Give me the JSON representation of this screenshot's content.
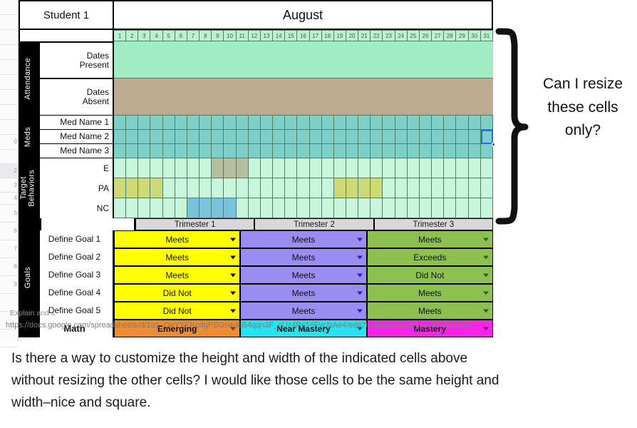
{
  "sheet": {
    "student_label": "Student 1",
    "month": "August",
    "days": [
      "1",
      "2",
      "3",
      "4",
      "5",
      "6",
      "7",
      "8",
      "9",
      "10",
      "11",
      "12",
      "13",
      "14",
      "15",
      "16",
      "17",
      "18",
      "19",
      "20",
      "21",
      "22",
      "23",
      "24",
      "25",
      "26",
      "27",
      "28",
      "29",
      "30",
      "31"
    ],
    "sections": [
      {
        "name": "Attendance",
        "rows": [
          "Dates\nPresent",
          "Dates\nAbsent"
        ]
      },
      {
        "name": "Meds",
        "rows": [
          "Med Name 1",
          "Med Name 2",
          "Med Name 3"
        ]
      },
      {
        "name": "Target\nBehaviors",
        "rows": [
          "E",
          "PA",
          "NC"
        ]
      },
      {
        "name": "Goals",
        "rows": [
          "Define Goal 1",
          "Define Goal 2",
          "Define Goal 3",
          "Define Goal 4",
          "Define Goal 5",
          "Math"
        ]
      }
    ],
    "trimesters": [
      "Trimester 1",
      "Trimester 2",
      "Trimester 3"
    ],
    "goal_values": [
      {
        "label": "Define Goal 1",
        "t1": "Meets",
        "t2": "Meets",
        "t3": "Meets"
      },
      {
        "label": "Define Goal 2",
        "t1": "Meets",
        "t2": "Meets",
        "t3": "Exceeds"
      },
      {
        "label": "Define Goal 3",
        "t1": "Meets",
        "t2": "Meets",
        "t3": "Did Not"
      },
      {
        "label": "Define Goal 4",
        "t1": "Did Not",
        "t2": "Meets",
        "t3": "Meets"
      },
      {
        "label": "Define Goal 5",
        "t1": "Did Not",
        "t2": "Meets",
        "t3": "Meets"
      },
      {
        "label": "Math",
        "t1": "Emerging",
        "t2": "Near Mastery",
        "t3": "Mastery"
      }
    ],
    "row_gutter_numbers": [
      "",
      "",
      "",
      "",
      "",
      "",
      "",
      "",
      "",
      "0",
      "",
      "2",
      "3",
      "4",
      "5",
      "6",
      "7",
      "8",
      "9"
    ]
  },
  "colors": {
    "present": "#9fecc5",
    "absent": "#bdab8f",
    "meds": "#7fcfc9",
    "behavior": "#c8f5dc",
    "behavior_e_highlight": "#b5bfa0",
    "behavior_pa_highlight": "#cddb77",
    "behavior_nc_highlight": "#79c3da",
    "grid_line": "#4e7f5e",
    "trimester_header": "#d8d8d8",
    "t1": "#ffff00",
    "t2": "#9a8cf0",
    "t3": "#8cc152",
    "math_t1": "#f08b31",
    "math_t2": "#27e2f2",
    "math_t3": "#f723e8",
    "selection": "#1a73e8"
  },
  "highlights": {
    "E": [
      9,
      10,
      11
    ],
    "PA": [
      1,
      2,
      3,
      4,
      19,
      20,
      21,
      22
    ],
    "NC": [
      7,
      8,
      9,
      10
    ]
  },
  "overlay": {
    "text_fragment": "Explain and s",
    "url": "https://docs.google.com/spreadsheets/d/1o1_QeYYEKcdgPSGna-lqB4qqn3F_cUz4Rc16FvcNAe4/edit?is=60244d52#gid=1878363647"
  },
  "annotation": {
    "line1": "Can I resize",
    "line2": "these cells",
    "line3": "only?"
  },
  "caption": {
    "line1": "Is there a way to customize the height and width of the indicated cells above",
    "line2": "without resizing the other cells? I would like those cells to be the same height and",
    "line3": "width–nice and square."
  }
}
